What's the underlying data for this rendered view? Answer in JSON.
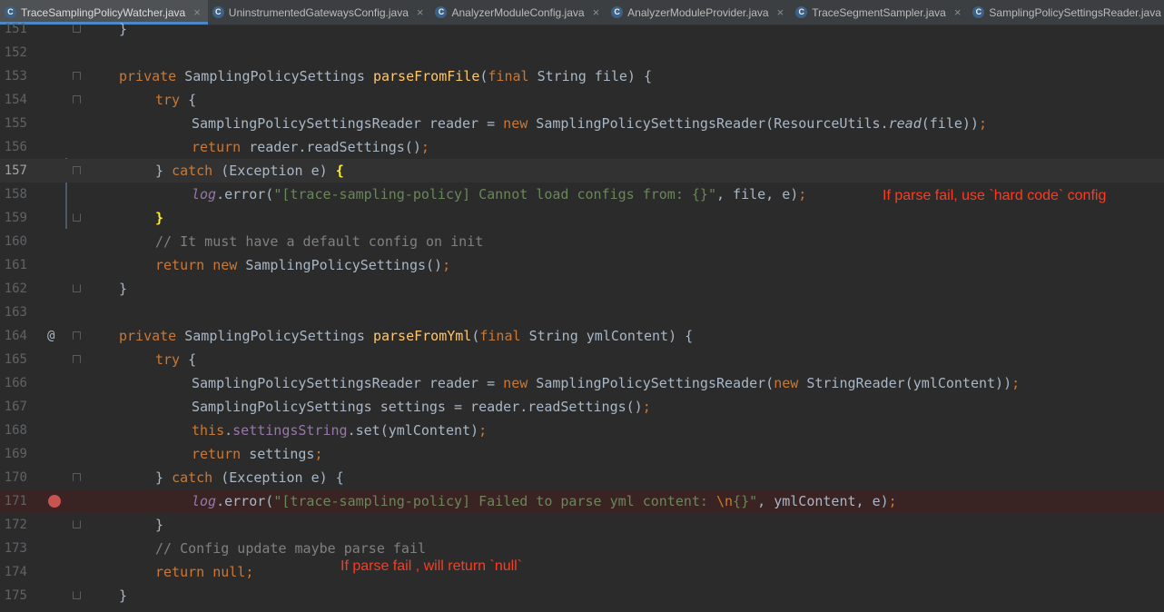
{
  "tabs": [
    {
      "label": "TraceSamplingPolicyWatcher.java",
      "active": true
    },
    {
      "label": "UninstrumentedGatewaysConfig.java"
    },
    {
      "label": "AnalyzerModuleConfig.java"
    },
    {
      "label": "AnalyzerModuleProvider.java"
    },
    {
      "label": "TraceSegmentSampler.java"
    },
    {
      "label": "SamplingPolicySettingsReader.java"
    }
  ],
  "tab_icon_letter": "C",
  "tab_close_glyph": "×",
  "gutter": {
    "lines": [
      "151",
      "152",
      "153",
      "154",
      "155",
      "156",
      "157",
      "158",
      "159",
      "160",
      "161",
      "162",
      "163",
      "164",
      "165",
      "166",
      "167",
      "168",
      "169",
      "170",
      "171",
      "172",
      "173",
      "174",
      "175"
    ],
    "current_line": "157",
    "override_marker": "@"
  },
  "code": {
    "l151": "}",
    "l153": {
      "kw": "private ",
      "type": "SamplingPolicySettings ",
      "fn": "parseFromFile",
      "p1": "(",
      "kw2": "final ",
      "rest": "String file) {"
    },
    "l154": {
      "kw": "try ",
      "rest": "{"
    },
    "l155": {
      "a": "SamplingPolicySettingsReader reader = ",
      "kw": "new ",
      "b": "SamplingPolicySettingsReader(ResourceUtils.",
      "it": "read",
      "c": "(file))",
      "semi": ";"
    },
    "l156": {
      "kw": "return ",
      "a": "reader.readSettings()",
      "semi": ";"
    },
    "l157": {
      "a": "} ",
      "kw": "catch ",
      "b": "(Exception e) ",
      "brace": "{"
    },
    "l158": {
      "log": "log",
      "a": ".error(",
      "str": "\"[trace-sampling-policy] Cannot load configs from: {}\"",
      "b": ", file, e)",
      "semi": ";"
    },
    "l159": {
      "brace": "}"
    },
    "l160": {
      "cmt": "// It must have a default config on init"
    },
    "l161": {
      "kw": "return new ",
      "a": "SamplingPolicySettings()",
      "semi": ";"
    },
    "l162": "}",
    "l164": {
      "kw": "private ",
      "type": "SamplingPolicySettings ",
      "fn": "parseFromYml",
      "p1": "(",
      "kw2": "final ",
      "rest": "String ymlContent) {"
    },
    "l165": {
      "kw": "try ",
      "rest": "{"
    },
    "l166": {
      "a": "SamplingPolicySettingsReader reader = ",
      "kw": "new ",
      "b": "SamplingPolicySettingsReader(",
      "kw2": "new ",
      "c": "StringReader(ymlContent))",
      "semi": ";"
    },
    "l167": {
      "a": "SamplingPolicySettings settings = reader.readSettings()",
      "semi": ";"
    },
    "l168": {
      "kw": "this",
      "a": ".",
      "fld": "settingsString",
      "b": ".set(ymlContent)",
      "semi": ";"
    },
    "l169": {
      "kw": "return ",
      "a": "settings",
      "semi": ";"
    },
    "l170": {
      "a": "} ",
      "kw": "catch ",
      "b": "(Exception e) {"
    },
    "l171": {
      "log": "log",
      "a": ".error(",
      "str1": "\"[trace-sampling-policy] Failed to parse yml content: ",
      "esc": "\\n",
      "str2": "{}\"",
      "b": ", ymlContent, e)",
      "semi": ";"
    },
    "l172": "}",
    "l173": {
      "cmt": "// Config update maybe parse fail"
    },
    "l174": {
      "kw": "return null",
      "semi": ";"
    },
    "l175": "}"
  },
  "annotations": {
    "note1": "If parse fail, use `hard code` config",
    "note2": "If parse fail , will return `null`"
  },
  "colors": {
    "background": "#2b2b2b",
    "keyword": "#cc7832",
    "function": "#ffc66d",
    "string": "#6a8759",
    "comment": "#808080",
    "field": "#9876aa",
    "annotation_text": "#ff3b1f",
    "breakpoint": "#c75450"
  }
}
